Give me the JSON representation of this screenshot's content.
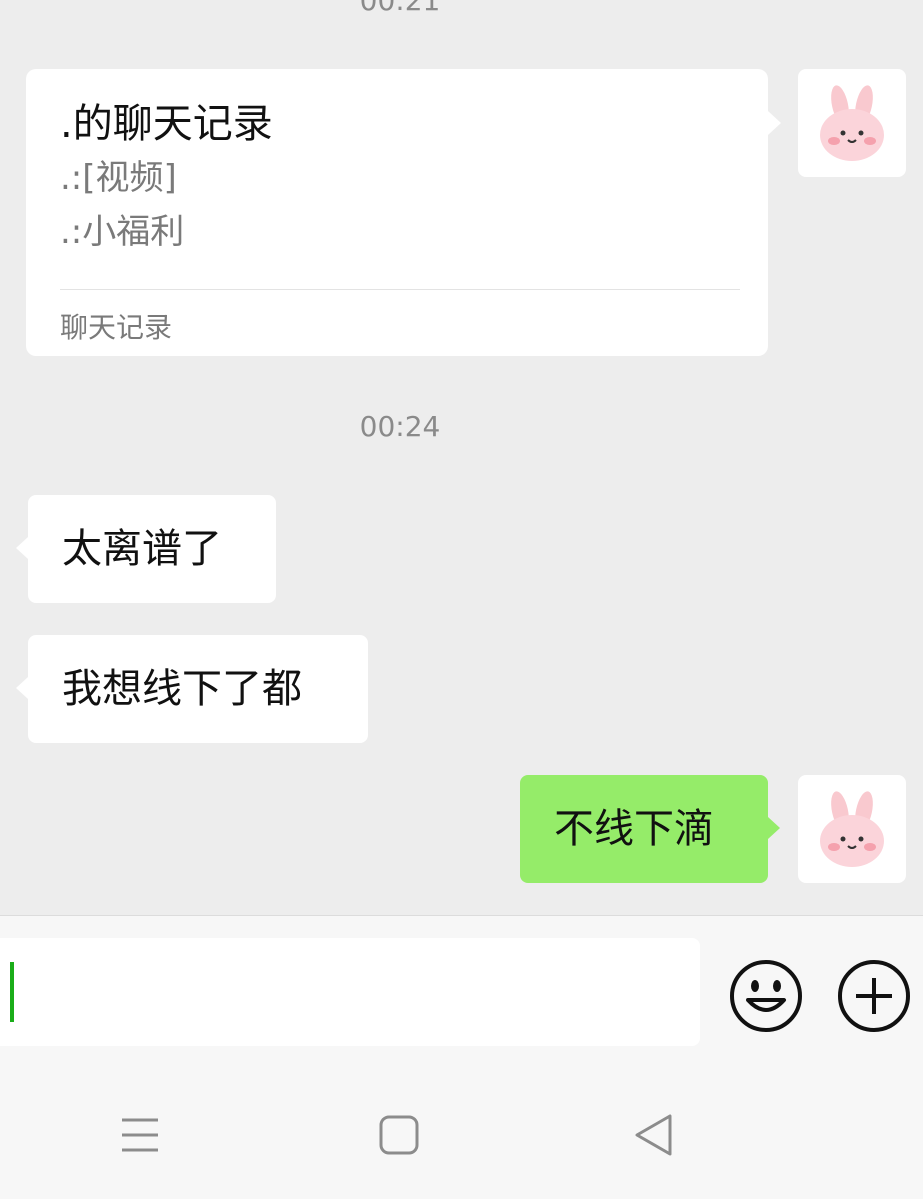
{
  "chat": {
    "timestamps": [
      "00:21",
      "00:24"
    ],
    "forward_card": {
      "title": ".的聊天记录",
      "lines": [
        ".:[视频]",
        ".:小福利"
      ],
      "footer": "聊天记录"
    },
    "messages": [
      {
        "side": "left",
        "text": "太离谱了"
      },
      {
        "side": "left",
        "text": "我想线下了都"
      },
      {
        "side": "right",
        "text": "不线下滴"
      }
    ],
    "colors": {
      "background": "#ededed",
      "outgoing_bubble": "#95ec69",
      "incoming_bubble": "#ffffff"
    }
  },
  "input": {
    "value": ""
  },
  "icons": {
    "avatar": "bunny-avatar-icon",
    "emoji": "smiley-icon",
    "plus": "plus-circle-icon",
    "nav_menu": "menu-icon",
    "nav_home": "home-square-icon",
    "nav_back": "back-triangle-icon"
  }
}
